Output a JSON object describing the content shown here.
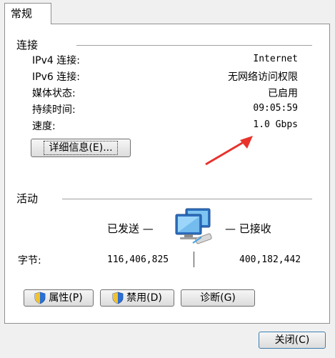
{
  "tabs": {
    "general": "常规"
  },
  "connection": {
    "group_title": "连接",
    "rows": [
      {
        "label": "IPv4 连接:",
        "value": "Internet"
      },
      {
        "label": "IPv6 连接:",
        "value": "无网络访问权限"
      },
      {
        "label": "媒体状态:",
        "value": "已启用"
      },
      {
        "label": "持续时间:",
        "value": "09:05:59"
      },
      {
        "label": "速度:",
        "value": "1.0 Gbps"
      }
    ],
    "details_button": "详细信息(E)..."
  },
  "activity": {
    "group_title": "活动",
    "sent_label": "已发送 —",
    "received_label": "— 已接收",
    "bytes_label": "字节:",
    "bytes_sent": "116,406,825",
    "bytes_received": "400,182,442"
  },
  "buttons": {
    "properties": "属性(P)",
    "disable": "禁用(D)",
    "diagnose": "诊断(G)",
    "close": "关闭(C)"
  },
  "icons": {
    "network": "network-computers-icon",
    "shield": "uac-shield-icon",
    "annotation": "red-arrow-annotation"
  },
  "colors": {
    "arrow": "#e8322b",
    "panel": "#ffffff",
    "window": "#f0f0f0"
  }
}
